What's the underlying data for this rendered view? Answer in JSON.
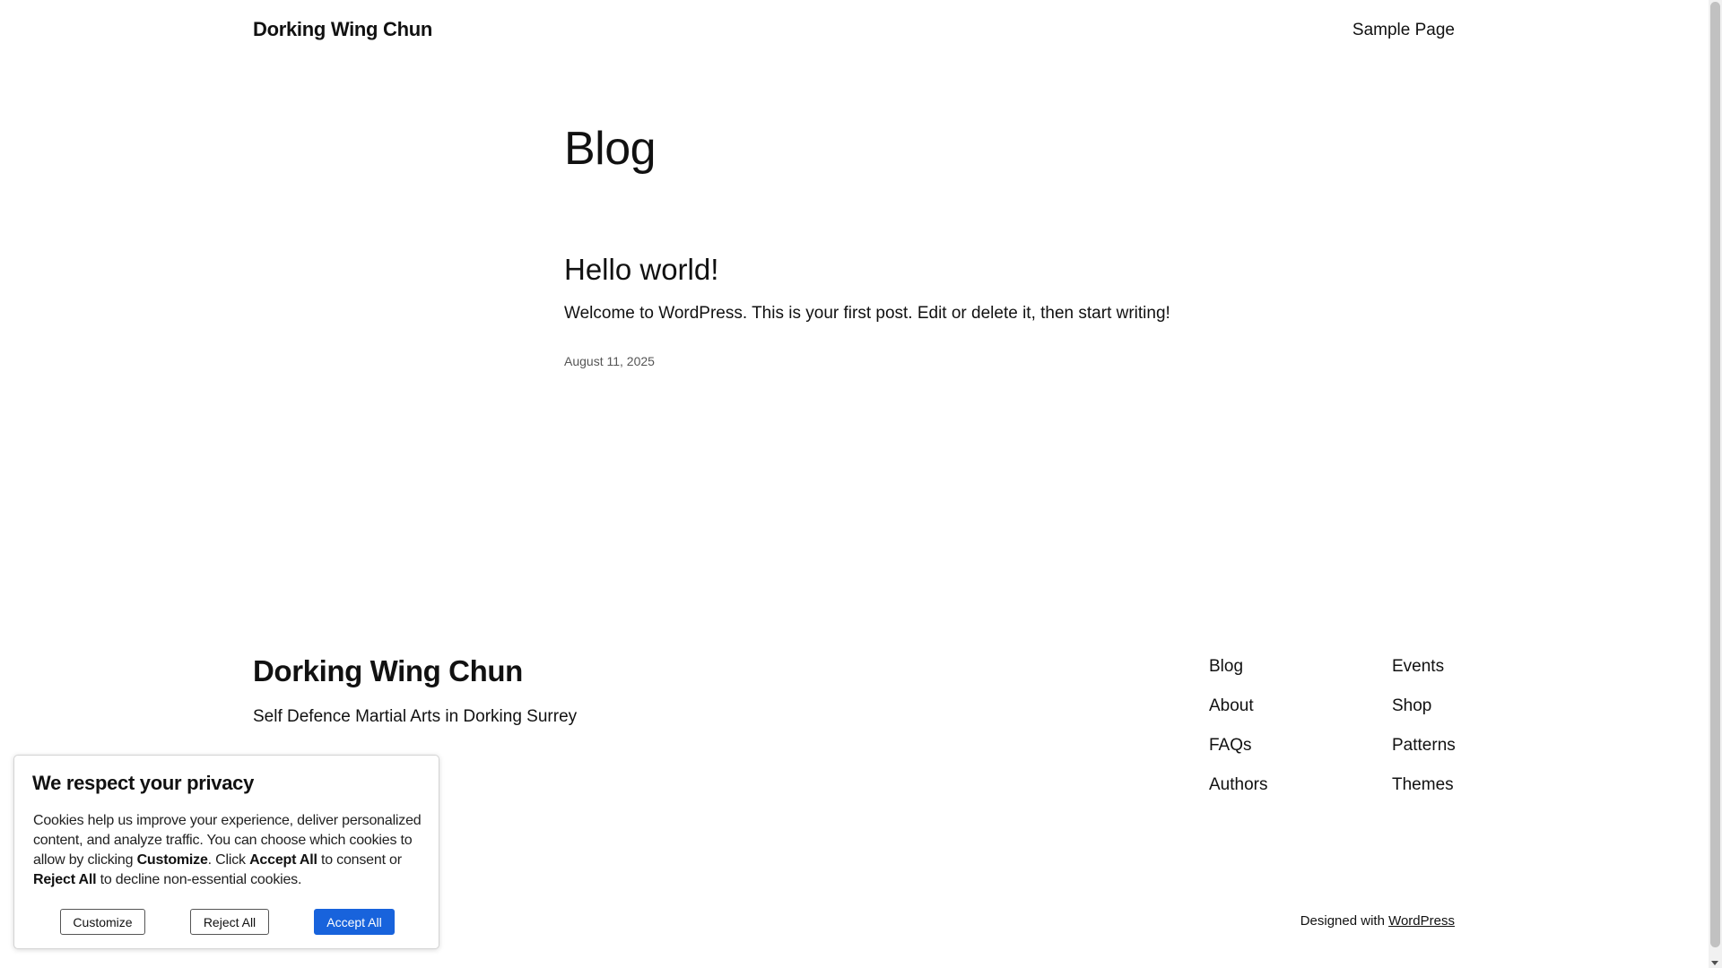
{
  "header": {
    "site_title": "Dorking Wing Chun",
    "nav_items": [
      "Sample Page"
    ]
  },
  "main": {
    "heading": "Blog",
    "posts": [
      {
        "title": "Hello world!",
        "excerpt": "Welcome to WordPress. This is your first post. Edit or delete it, then start writing!",
        "date": "August 11, 2025"
      }
    ]
  },
  "footer": {
    "site_title": "Dorking Wing Chun",
    "tagline": "Self Defence Martial Arts in Dorking Surrey",
    "nav_col1": [
      "Blog",
      "About",
      "FAQs",
      "Authors"
    ],
    "nav_col2": [
      "Events",
      "Shop",
      "Patterns",
      "Themes"
    ],
    "credits_prefix": "Designed with ",
    "credits_link": "WordPress"
  },
  "cookie_banner": {
    "title": "We respect your privacy",
    "text_1": "Cookies help us improve your experience, deliver personalized content, and analyze traffic. You can choose which cookies to allow by clicking ",
    "text_bold_customize": "Customize",
    "text_2": ". Click ",
    "text_bold_accept": "Accept All",
    "text_3": " to consent or ",
    "text_bold_reject": "Reject All",
    "text_4": " to decline non-essential cookies.",
    "customize_label": "Customize",
    "reject_label": "Reject All",
    "accept_label": "Accept All",
    "accept_color": "#1863dc"
  }
}
